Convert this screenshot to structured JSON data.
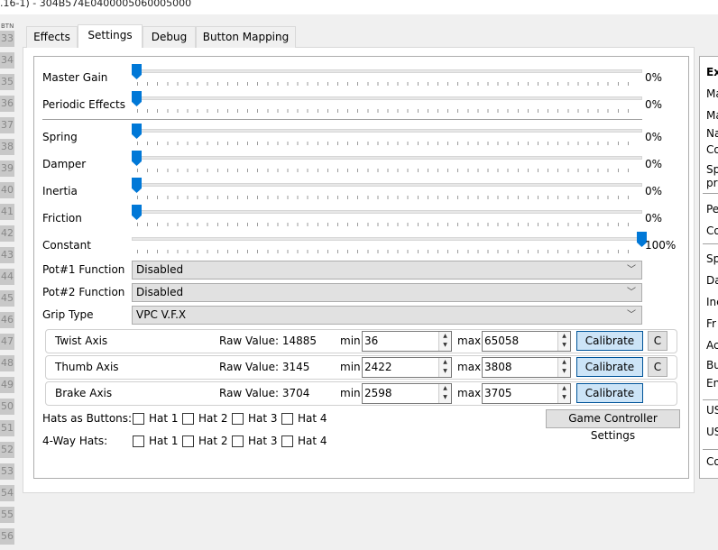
{
  "window": {
    "title": ".16-1) - 304B574E0400005060005000"
  },
  "btn_column": {
    "header": "BTN",
    "numbers": [
      "33",
      "34",
      "35",
      "36",
      "37",
      "38",
      "39",
      "40",
      "41",
      "42",
      "43",
      "44",
      "45",
      "46",
      "47",
      "48",
      "49",
      "50",
      "51",
      "52",
      "53",
      "54",
      "55",
      "56"
    ]
  },
  "tabs": [
    {
      "label": "Effects"
    },
    {
      "label": "Settings",
      "active": true
    },
    {
      "label": "Debug"
    },
    {
      "label": "Button Mapping"
    }
  ],
  "sliders": [
    {
      "label": "Master Gain",
      "value": 0,
      "display": "0%"
    },
    {
      "label": "Periodic Effects",
      "value": 0,
      "display": "0%"
    },
    {
      "label": "Spring",
      "value": 0,
      "display": "0%"
    },
    {
      "label": "Damper",
      "value": 0,
      "display": "0%"
    },
    {
      "label": "Inertia",
      "value": 0,
      "display": "0%"
    },
    {
      "label": "Friction",
      "value": 0,
      "display": "0%"
    },
    {
      "label": "Constant",
      "value": 100,
      "display": "100%"
    }
  ],
  "combos": [
    {
      "label": "Pot#1 Function",
      "value": "Disabled"
    },
    {
      "label": "Pot#2 Function",
      "value": "Disabled"
    },
    {
      "label": "Grip Type",
      "value": "VPC V.F.X"
    }
  ],
  "axes": [
    {
      "name": "Twist Axis",
      "raw": "Raw Value: 14885",
      "min": "36",
      "max": "65058",
      "has_c": true
    },
    {
      "name": "Thumb Axis",
      "raw": "Raw Value: 3145",
      "min": "2422",
      "max": "3808",
      "has_c": true
    },
    {
      "name": "Brake Axis",
      "raw": "Raw Value: 3704",
      "min": "2598",
      "max": "3705",
      "has_c": false
    }
  ],
  "axis_labels": {
    "min": "min",
    "max": "max",
    "calibrate": "Calibrate",
    "c": "C"
  },
  "hats": {
    "buttons_label": "Hats as Buttons:",
    "fourway_label": "4-Way Hats:",
    "items": [
      "Hat 1",
      "Hat 2",
      "Hat 3",
      "Hat 4"
    ]
  },
  "game_controller_settings": "Game Controller Settings",
  "right_panel": [
    "Ex",
    "Ma",
    "Ma",
    "Na",
    "Co",
    "Sp",
    "pr",
    "Pe",
    "Co",
    "Sp",
    "Da",
    "Ine",
    "Fr",
    "Ac",
    "Bu",
    "En",
    "US",
    "US",
    "Co"
  ]
}
